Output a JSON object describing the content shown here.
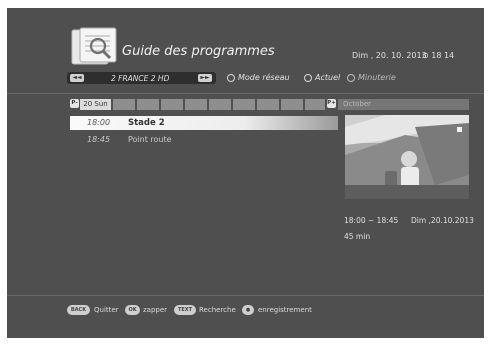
{
  "header": {
    "title": "Guide des programmes",
    "date": "Dim , 20. 10. 2013",
    "time": "⊙ 18 14"
  },
  "channel_bar": {
    "prev_icon": "rewind-icon",
    "next_icon": "fast-forward-icon",
    "prev_glyph": "◄◄",
    "next_glyph": "►►",
    "channel_name": "2 FRANCE 2 HD",
    "options": [
      {
        "label": "Mode réseau"
      },
      {
        "label": "Actuel"
      },
      {
        "label": "Minuterie"
      }
    ]
  },
  "day_tabs": {
    "page_left_label": "P-",
    "page_right_label": "P+",
    "selected_day": "20 Sun",
    "month": "October"
  },
  "programs": [
    {
      "time": "18:00",
      "title": "Stade 2",
      "selected": true
    },
    {
      "time": "18:45",
      "title": "Point route",
      "selected": false
    }
  ],
  "program_info": {
    "time_range": "18:00 ~ 18:45",
    "date": "Dim ,20.10.2013",
    "duration": "45 min"
  },
  "footer": {
    "items": [
      {
        "key": "BACK",
        "label": "Quitter"
      },
      {
        "key": "OK",
        "label": "zapper"
      },
      {
        "key": "TEXT",
        "label": "Recherche"
      },
      {
        "key": "●",
        "label": "enregistrement"
      }
    ]
  },
  "colors": {
    "background": "#4f4f4f",
    "selection": "#f0f0f0",
    "text": "#e8e8e8"
  }
}
